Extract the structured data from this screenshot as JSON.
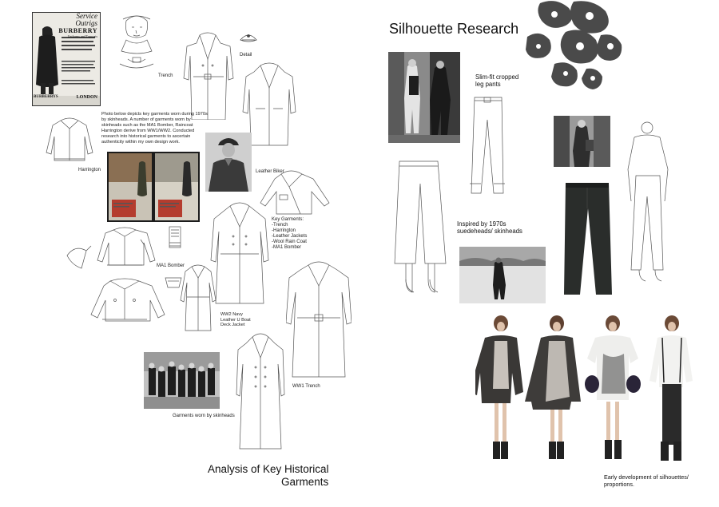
{
  "left_page": {
    "poster": {
      "heading_1": "Service",
      "heading_2": "Outrigs",
      "brand": "BURBERRY",
      "sub": "Uniforms and Topcoats",
      "footer_brand": "BURBERRYS",
      "footer_city": "LONDON"
    },
    "labels": {
      "trench": "Trench",
      "detail": "Detail",
      "harrington": "Harrington",
      "leather_biker": "Leather Biker",
      "ma1_bomber": "MA1 Bomber",
      "ww2_navy": "WW2 Navy\nLeather U Boat\nDeck Jacket",
      "ww1_trench": "WW1 Trench",
      "garments_worn": "Garments worn by skinheads"
    },
    "description": "Photo below depicts key garments worn during 1970s by skinheads. A number of garments worn by skinheads such as the MA1 Bomber, Raincoat Harrington derive from WW1/WW2. Conducted research into historical garments to ascertain authenticity within my own design work.",
    "key_garments": "Key Garments:\n-Trench\n-Harrington\n-Leather Jackets\n-Wool Rain Coat\n-MA1 Bomber",
    "title_line1": "Analysis of Key Historical",
    "title_line2": "Garments"
  },
  "right_page": {
    "title": "Silhouette Research",
    "slim_fit": "Slim-fit cropped\nleg pants",
    "inspired": "Inspired by 1970s\nsuedeheads/ skinheads",
    "early_dev": "Early development of silhouettes/\nproportions."
  },
  "colors": {
    "ink": "#111111",
    "sketch_line": "#555555",
    "photo_dark": "#2a2a2a",
    "photo_mid": "#8a8a8a",
    "brush": "#4a4a4a"
  }
}
